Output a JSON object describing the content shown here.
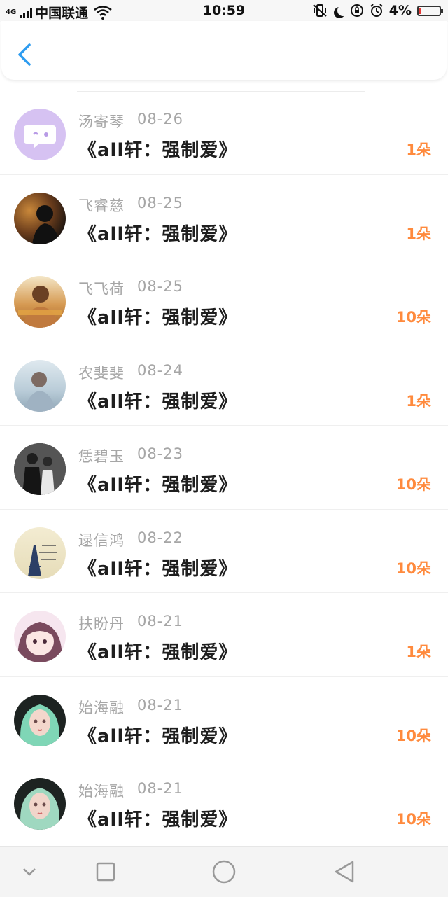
{
  "status_bar": {
    "network": "4G",
    "carrier": "中国联通",
    "time": "10:59",
    "battery": "4%",
    "battery_color": "#e53935"
  },
  "header": {
    "back_icon": "chevron-left-icon",
    "accent": "#2d9cf0"
  },
  "records": [
    {
      "name": "汤寄琴",
      "date": "08-26",
      "book": "《all轩：强制爱》",
      "count": "1朵",
      "avatar": "chat-bubble-avatar"
    },
    {
      "name": "飞睿慈",
      "date": "08-25",
      "book": "《all轩：强制爱》",
      "count": "1朵",
      "avatar": "photo-avatar"
    },
    {
      "name": "飞飞荷",
      "date": "08-25",
      "book": "《all轩：强制爱》",
      "count": "10朵",
      "avatar": "photo-avatar"
    },
    {
      "name": "农斐斐",
      "date": "08-24",
      "book": "《all轩：强制爱》",
      "count": "1朵",
      "avatar": "photo-avatar"
    },
    {
      "name": "恁碧玉",
      "date": "08-23",
      "book": "《all轩：强制爱》",
      "count": "10朵",
      "avatar": "photo-avatar"
    },
    {
      "name": "逯信鸿",
      "date": "08-22",
      "book": "《all轩：强制爱》",
      "count": "10朵",
      "avatar": "photo-avatar"
    },
    {
      "name": "扶盼丹",
      "date": "08-21",
      "book": "《all轩：强制爱》",
      "count": "1朵",
      "avatar": "photo-avatar"
    },
    {
      "name": "始海融",
      "date": "08-21",
      "book": "《all轩：强制爱》",
      "count": "10朵",
      "avatar": "photo-avatar"
    },
    {
      "name": "始海融",
      "date": "08-21",
      "book": "《all轩：强制爱》",
      "count": "10朵",
      "avatar": "photo-avatar"
    }
  ],
  "count_color": "#ff8a3d",
  "nav": {
    "items": [
      "chevron-down-icon",
      "square-icon",
      "circle-icon",
      "triangle-back-icon"
    ]
  }
}
